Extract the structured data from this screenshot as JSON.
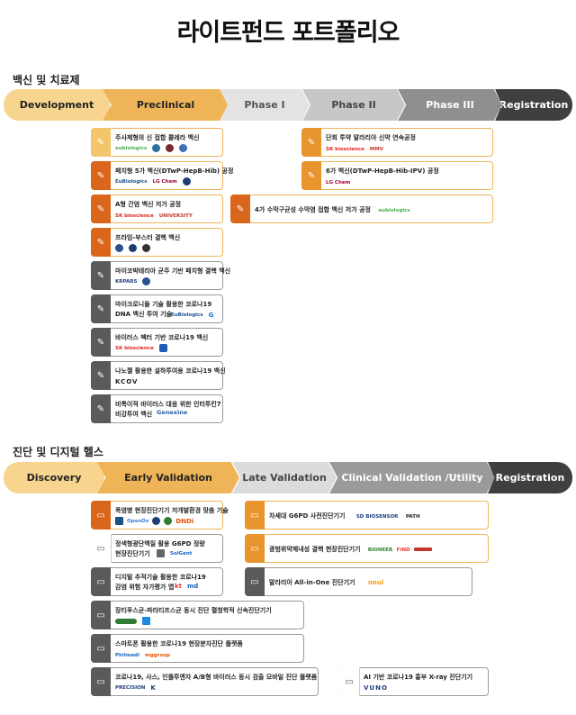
{
  "title": "라이트펀드 포트폴리오",
  "section1": {
    "heading": "백신 및 치료제",
    "stages": [
      "Development",
      "Preclinical",
      "Phase I",
      "Phase II",
      "Phase III",
      "Registration"
    ]
  },
  "section2": {
    "heading": "진단 및 디지털 헬스",
    "stages": [
      "Discovery",
      "Early Validation",
      "Late Validation",
      "Clinical Validation /Utility",
      "Registration"
    ]
  },
  "cards1": [
    {
      "text": "주사제형의 신 접합 콜레라 백신",
      "logos": [
        "eubiologics",
        "emblem",
        "emblem",
        "emblem"
      ]
    },
    {
      "text": "패치형 5가 백신(DTwP-HepB-Hib) 공정",
      "logos": [
        "EuBiologics",
        "LG Chem",
        "emblem"
      ]
    },
    {
      "text": "A형 간염 백신 저가 공정",
      "logos": [
        "SK bioscience",
        "UNIVERSITY"
      ]
    },
    {
      "text": "프라임-부스터 결핵 백신",
      "logos": [
        "emblem",
        "emblem",
        "emblem"
      ]
    },
    {
      "text": "마이코박테리아 균주 기반 패치형 결핵 백신",
      "logos": [
        "KRPARS",
        "emblem"
      ]
    },
    {
      "text": "마이크로니들 기술 활용한 코로나19",
      "text2": "DNA 백신 투여 기술",
      "logos": [
        "EuBiologics",
        "G"
      ]
    },
    {
      "text": "바이러스 벡터 기반 코로나19 백신",
      "logos": [
        "SK bioscience",
        "emblem"
      ]
    },
    {
      "text": "나노젤 활용한 설하투여용 코로나19 백신",
      "logos": [
        "KCOV"
      ]
    },
    {
      "text": "비특이적 바이러스 대응 위한 인터루킨7",
      "text2": "비강투여 백신",
      "logos": [
        "Genexine"
      ]
    },
    {
      "text": "단회 투약 말라리아 신약 연속공정",
      "logos": [
        "SK bioscience",
        "MMV"
      ]
    },
    {
      "text": "6가 백신(DTwP-HepB-Hib-IPV) 공정",
      "logos": [
        "LG Chem"
      ]
    },
    {
      "text": "4가 수막구균성 수막염 접합 백신 저가 공정",
      "logos": [
        "eubiologics"
      ]
    }
  ],
  "cards2": [
    {
      "text": "폭염병 현장진단기기 저개발환경 맞춤 기술",
      "logos": [
        "emblem",
        "OpenDx",
        "emblem",
        "emblem",
        "DNDi"
      ]
    },
    {
      "text": "정색형광단백질 활용 G6PD 정량",
      "text2": "현장진단기기",
      "logos": [
        "emblem",
        "SolGent"
      ]
    },
    {
      "text": "디지털 추적기술 활용한 코로나19",
      "text2": "감염 위험 자가평가 앱",
      "logos": [
        "kt",
        "md"
      ]
    },
    {
      "text": "장티푸스균-파라티프스균 동시 진단 혈청학적 신속진단기기",
      "logos": [
        "emblem",
        "emblem"
      ]
    },
    {
      "text": "스마트폰 활용한 코로나19 현장분자진단 플랫폼",
      "logos": [
        "Philmedi",
        "mggroup"
      ]
    },
    {
      "text": "코로나19, 사스, 인플루엔자 A/B형 바이러스 동시 검출 모바일 진단 플랫폼",
      "logos": [
        "PRECISION",
        "K"
      ]
    },
    {
      "text": "차세대 G6PD 사전진단기기",
      "logos": [
        "SD BIOSENSOR",
        "PATH"
      ]
    },
    {
      "text": "광범위약제내성 결핵 현장진단기기",
      "logos": [
        "BIONEER",
        "FIND",
        "emblem"
      ]
    },
    {
      "text": "말라리아 All-in-One 진단기기",
      "logos": [
        "noul"
      ]
    },
    {
      "text": "AI 기반 코로나19 흉부 X-ray 진단기기",
      "logos": [
        "VUNO"
      ]
    }
  ],
  "colors": {
    "light_orange": "#f5c56c",
    "orange": "#ef9d2c",
    "dark_orange": "#d9661a",
    "gray_dark": "#3f3f3f"
  }
}
